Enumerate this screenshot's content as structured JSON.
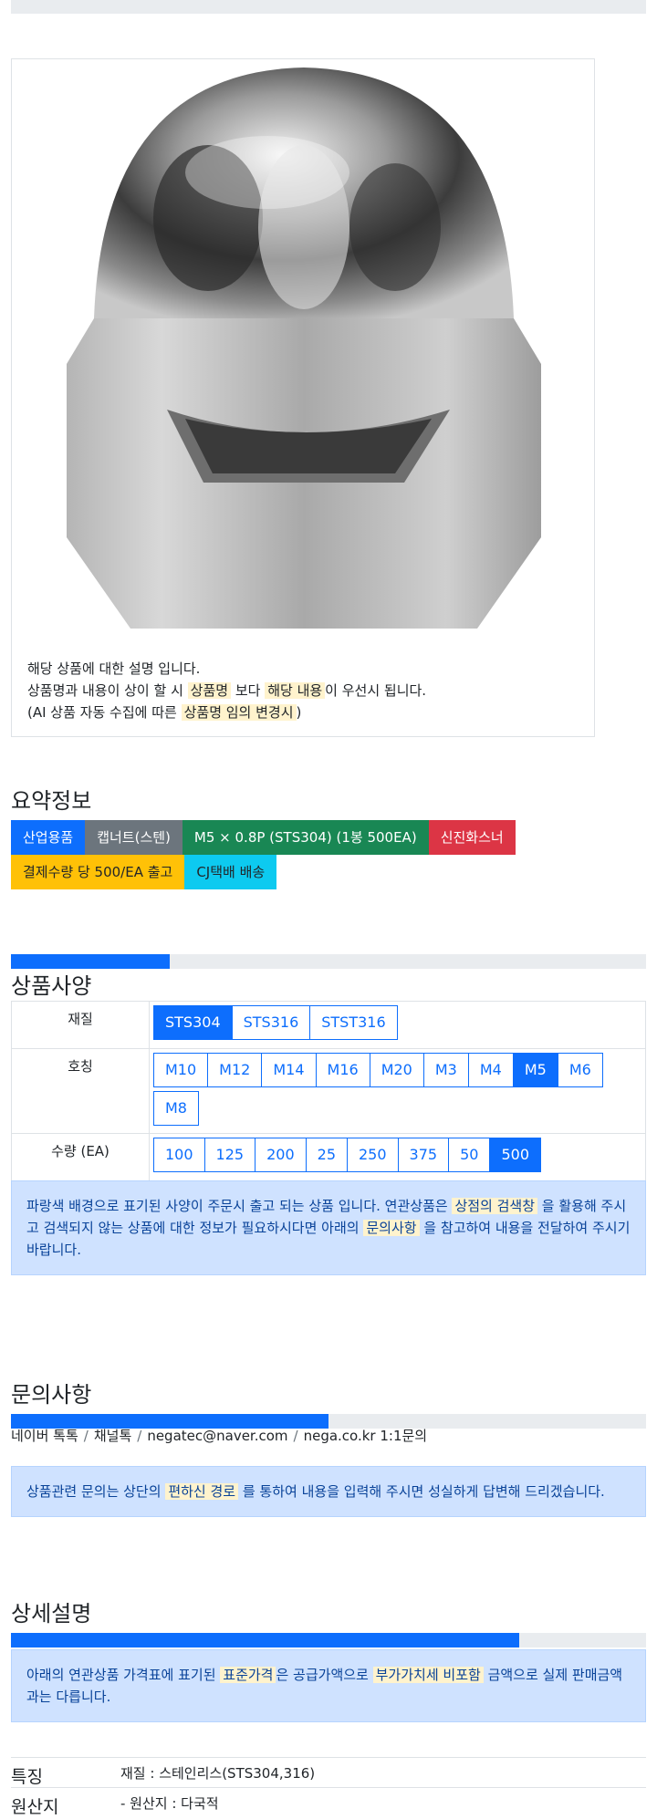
{
  "description": {
    "line1": "해당 상품에 대한 설명 입니다.",
    "line2_a": "상품명과 내용이 상이 할 시 ",
    "line2_hl1": "상품명",
    "line2_b": " 보다 ",
    "line2_hl2": "해당 내용",
    "line2_c": "이 우선시 됩니다.",
    "line3_a": "(AI 상품 자동 수집에 따른 ",
    "line3_hl": "상품명 임의 변경시",
    "line3_b": ")"
  },
  "summary": {
    "title": "요약정보",
    "badges": [
      "산업용품",
      "캡너트(스텐)",
      "M5 × 0.8P (STS304) (1봉 500EA)",
      "신진화스너",
      "결제수량 당 500/EA 출고",
      "CJ택배 배송"
    ]
  },
  "spec": {
    "title": "상품사양",
    "progress": 0.25,
    "rows": [
      {
        "label": "재질",
        "options": [
          "STS304",
          "STS316",
          "STST316"
        ],
        "active": "STS304"
      },
      {
        "label": "호칭",
        "options": [
          "M10",
          "M12",
          "M14",
          "M16",
          "M20",
          "M3",
          "M4",
          "M5",
          "M6",
          "M8"
        ],
        "active": "M5"
      },
      {
        "label": "수량 (EA)",
        "options": [
          "100",
          "125",
          "200",
          "25",
          "250",
          "375",
          "50",
          "500"
        ],
        "active": "500"
      }
    ],
    "notice_a": "파랑색 배경으로 표기된 사양이 주문시 출고 되는 상품 입니다. 연관상품은 ",
    "notice_hl1": "상점의 검색창",
    "notice_b": " 을 활용해 주시고 검색되지 않는 상품에 대한 정보가 필요하시다면 아래의 ",
    "notice_hl2": "문의사항",
    "notice_c": " 을 참고하여 내용을 전달하여 주시기 바랍니다."
  },
  "inquiry": {
    "title": "문의사항",
    "progress": 0.5,
    "links": [
      "네이버 톡톡",
      "채널톡",
      "negatec@naver.com",
      "nega.co.kr 1:1문의"
    ],
    "notice_a": "상품관련 문의는 상단의 ",
    "notice_hl": "편하신 경로",
    "notice_b": " 를 통하여 내용을 입력해 주시면 성실하게 답변해 드리겠습니다."
  },
  "detail": {
    "title": "상세설명",
    "progress": 0.8,
    "notice_a": "아래의 연관상품 가격표에 표기된 ",
    "notice_hl1": "표준가격",
    "notice_b": "은 공급가액으로 ",
    "notice_hl2": "부가가치세 비포함",
    "notice_c": " 금액으로 실제 판매금액과는 다릅니다.",
    "features": [
      {
        "key": "특징",
        "value": "재질 : 스테인리스(STS304,316)"
      },
      {
        "key": "원산지",
        "value": "- 원산지 : 다국적"
      }
    ]
  },
  "colors": {
    "primary": "#0d6efd",
    "alert_bg": "#cfe2ff",
    "highlight": "#fff3cd"
  }
}
